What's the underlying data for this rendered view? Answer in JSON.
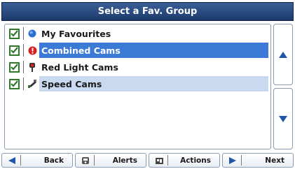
{
  "title": "Select a Fav. Group",
  "groups": [
    {
      "label": "My Favourites",
      "checked": true,
      "icon": "globe-icon",
      "state": "normal"
    },
    {
      "label": "Combined Cams",
      "checked": true,
      "icon": "warning-icon",
      "state": "selected"
    },
    {
      "label": "Red Light Cams",
      "checked": true,
      "icon": "traffic-light-icon",
      "state": "normal"
    },
    {
      "label": "Speed Cams",
      "checked": true,
      "icon": "speed-camera-icon",
      "state": "highlighted"
    }
  ],
  "toolbar": {
    "back": {
      "label": "Back",
      "icon": "arrow-left-icon"
    },
    "alerts": {
      "label": "Alerts",
      "icon": "alerts-icon"
    },
    "actions": {
      "label": "Actions",
      "icon": "actions-icon"
    },
    "next": {
      "label": "Next",
      "icon": "arrow-right-icon"
    }
  },
  "colors": {
    "title_bg": "#2b4d82",
    "selected_bg": "#3b7ad6",
    "highlight_bg": "#c9d9ef",
    "check_green": "#2f7a2f",
    "arrow_blue": "#1f55a8"
  }
}
